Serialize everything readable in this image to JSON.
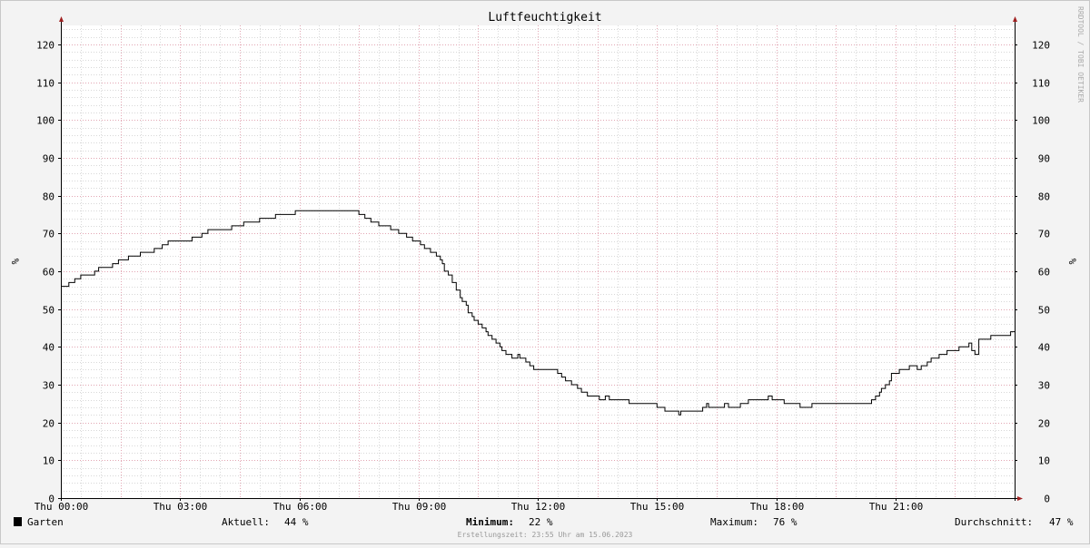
{
  "chart_data": {
    "type": "line",
    "title": "Luftfeuchtigkeit",
    "ylabel": "%",
    "ylabel_right": "%",
    "watermark": "RRDTOOL / TOBI OETIKER",
    "ylim": [
      0,
      125
    ],
    "y_ticks": [
      0,
      10,
      20,
      30,
      40,
      50,
      60,
      70,
      80,
      90,
      100,
      110,
      120
    ],
    "x_range_hours": [
      0,
      24
    ],
    "x_ticks": [
      {
        "hour": 0,
        "label": "Thu 00:00"
      },
      {
        "hour": 3,
        "label": "Thu 03:00"
      },
      {
        "hour": 6,
        "label": "Thu 06:00"
      },
      {
        "hour": 9,
        "label": "Thu 09:00"
      },
      {
        "hour": 12,
        "label": "Thu 12:00"
      },
      {
        "hour": 15,
        "label": "Thu 15:00"
      },
      {
        "hour": 18,
        "label": "Thu 18:00"
      },
      {
        "hour": 21,
        "label": "Thu 21:00"
      }
    ],
    "grid": true,
    "series": [
      {
        "name": "Garten",
        "color": "#000000",
        "points": [
          [
            0.0,
            56
          ],
          [
            0.2,
            57
          ],
          [
            0.35,
            58
          ],
          [
            0.5,
            59
          ],
          [
            0.85,
            60
          ],
          [
            0.95,
            61
          ],
          [
            1.3,
            62
          ],
          [
            1.45,
            63
          ],
          [
            1.7,
            64
          ],
          [
            2.0,
            65
          ],
          [
            2.35,
            66
          ],
          [
            2.55,
            67
          ],
          [
            2.7,
            68
          ],
          [
            3.3,
            69
          ],
          [
            3.55,
            70
          ],
          [
            3.7,
            71
          ],
          [
            4.3,
            72
          ],
          [
            4.6,
            73
          ],
          [
            5.0,
            74
          ],
          [
            5.4,
            75
          ],
          [
            5.9,
            76
          ],
          [
            7.4,
            76
          ],
          [
            7.5,
            75
          ],
          [
            7.65,
            74
          ],
          [
            7.8,
            73
          ],
          [
            8.0,
            72
          ],
          [
            8.3,
            71
          ],
          [
            8.5,
            70
          ],
          [
            8.7,
            69
          ],
          [
            8.85,
            68
          ],
          [
            9.05,
            67
          ],
          [
            9.15,
            66
          ],
          [
            9.3,
            65
          ],
          [
            9.45,
            64
          ],
          [
            9.55,
            63
          ],
          [
            9.6,
            62
          ],
          [
            9.65,
            60
          ],
          [
            9.75,
            59
          ],
          [
            9.85,
            57
          ],
          [
            9.95,
            55
          ],
          [
            10.05,
            53
          ],
          [
            10.1,
            52
          ],
          [
            10.2,
            51
          ],
          [
            10.25,
            49
          ],
          [
            10.35,
            48
          ],
          [
            10.4,
            47
          ],
          [
            10.5,
            46
          ],
          [
            10.6,
            45
          ],
          [
            10.7,
            44
          ],
          [
            10.75,
            43
          ],
          [
            10.85,
            42
          ],
          [
            10.95,
            41
          ],
          [
            11.05,
            40
          ],
          [
            11.1,
            39
          ],
          [
            11.2,
            38
          ],
          [
            11.35,
            37
          ],
          [
            11.5,
            38
          ],
          [
            11.55,
            37
          ],
          [
            11.7,
            36
          ],
          [
            11.8,
            35
          ],
          [
            11.9,
            34
          ],
          [
            12.3,
            34
          ],
          [
            12.5,
            33
          ],
          [
            12.6,
            32
          ],
          [
            12.7,
            31
          ],
          [
            12.85,
            30
          ],
          [
            13.0,
            29
          ],
          [
            13.1,
            28
          ],
          [
            13.25,
            27
          ],
          [
            13.55,
            26
          ],
          [
            13.7,
            27
          ],
          [
            13.8,
            26
          ],
          [
            14.3,
            25
          ],
          [
            15.0,
            24
          ],
          [
            15.2,
            23
          ],
          [
            15.55,
            22
          ],
          [
            15.6,
            23
          ],
          [
            16.0,
            23
          ],
          [
            16.15,
            24
          ],
          [
            16.25,
            25
          ],
          [
            16.3,
            24
          ],
          [
            16.7,
            25
          ],
          [
            16.8,
            24
          ],
          [
            17.1,
            25
          ],
          [
            17.3,
            26
          ],
          [
            17.8,
            27
          ],
          [
            17.9,
            26
          ],
          [
            18.2,
            25
          ],
          [
            18.6,
            24
          ],
          [
            18.9,
            25
          ],
          [
            20.3,
            25
          ],
          [
            20.4,
            26
          ],
          [
            20.5,
            27
          ],
          [
            20.6,
            28
          ],
          [
            20.65,
            29
          ],
          [
            20.75,
            30
          ],
          [
            20.85,
            31
          ],
          [
            20.9,
            33
          ],
          [
            21.1,
            34
          ],
          [
            21.35,
            35
          ],
          [
            21.55,
            34
          ],
          [
            21.65,
            35
          ],
          [
            21.8,
            36
          ],
          [
            21.9,
            37
          ],
          [
            22.1,
            38
          ],
          [
            22.3,
            39
          ],
          [
            22.6,
            40
          ],
          [
            22.85,
            41
          ],
          [
            22.92,
            39
          ],
          [
            23.0,
            38
          ],
          [
            23.1,
            42
          ],
          [
            23.4,
            43
          ],
          [
            23.9,
            44
          ],
          [
            24.0,
            44
          ]
        ]
      }
    ]
  },
  "legend": {
    "series_name": "Garten",
    "current_label": "Aktuell:",
    "current_value": "44 %",
    "min_label": "Minimum:",
    "min_value": "22 %",
    "max_label": "Maximum:",
    "max_value": "76 %",
    "avg_label": "Durchschnitt:",
    "avg_value": "47 %"
  },
  "footer": {
    "timestamp": "Erstellungszeit: 23:55 Uhr am 15.06.2023"
  },
  "colors": {
    "background": "#f3f3f3",
    "plot_background": "#ffffff",
    "major_grid": "#e2a6b3",
    "minor_grid": "#d8d8d8",
    "axis": "#000000",
    "arrow": "#a02020"
  }
}
